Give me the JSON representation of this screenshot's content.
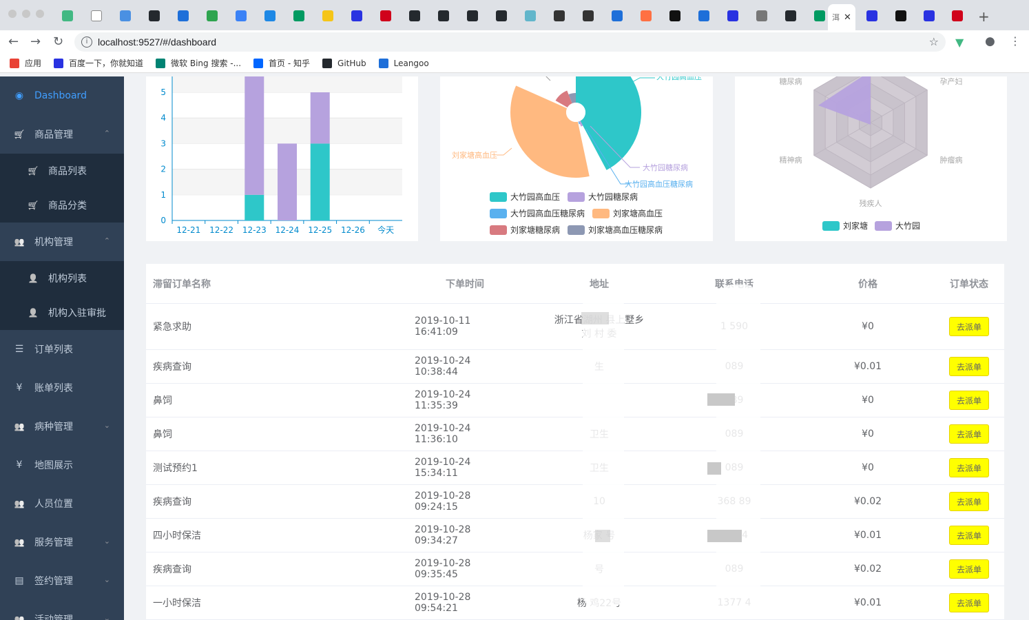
{
  "browser": {
    "url": "localhost:9527/#/dashboard",
    "active_tab_label": "洱"
  },
  "bookmarks": [
    {
      "label": "应用",
      "icon": "apps-grid-icon",
      "color": "#e94235"
    },
    {
      "label": "百度一下，你就知道",
      "icon": "baidu-paw-icon",
      "color": "#2932e1"
    },
    {
      "label": "微软 Bing 搜索 -...",
      "icon": "bing-icon",
      "color": "#008373"
    },
    {
      "label": "首页 - 知乎",
      "icon": "zhihu-icon",
      "color": "#0066ff"
    },
    {
      "label": "GitHub",
      "icon": "github-icon",
      "color": "#24292e"
    },
    {
      "label": "Leangoo",
      "icon": "leangoo-icon",
      "color": "#1e6fd9"
    }
  ],
  "sidebar": {
    "items": [
      {
        "label": "Dashboard",
        "icon": "dashboard-icon",
        "active": true
      },
      {
        "label": "商品管理",
        "icon": "cart-icon",
        "arrow": "up"
      },
      {
        "label": "商品列表",
        "icon": "cart-icon",
        "sub": true
      },
      {
        "label": "商品分类",
        "icon": "cart-icon",
        "sub": true
      },
      {
        "label": "机构管理",
        "icon": "user-icon",
        "arrow": "up"
      },
      {
        "label": "机构列表",
        "icon": "person-icon",
        "sub": true
      },
      {
        "label": "机构入驻审批",
        "icon": "person-icon",
        "sub": true
      },
      {
        "label": "订单列表",
        "icon": "list-icon"
      },
      {
        "label": "账单列表",
        "icon": "yen-icon"
      },
      {
        "label": "病种管理",
        "icon": "user-icon",
        "arrow": "down"
      },
      {
        "label": "地图展示",
        "icon": "yen-icon"
      },
      {
        "label": "人员位置",
        "icon": "user-icon"
      },
      {
        "label": "服务管理",
        "icon": "user-icon",
        "arrow": "down"
      },
      {
        "label": "签约管理",
        "icon": "document-icon",
        "arrow": "down"
      },
      {
        "label": "活动管理",
        "icon": "user-icon",
        "arrow": "down"
      }
    ]
  },
  "chart_data": [
    {
      "type": "bar",
      "stacked": true,
      "categories": [
        "12-21",
        "12-22",
        "12-23",
        "12-24",
        "12-25",
        "12-26",
        "今天"
      ],
      "yticks": [
        "0",
        "1",
        "2",
        "3",
        "4",
        "5"
      ],
      "ylim": [
        0,
        5
      ],
      "series": [
        {
          "values": [
            0,
            0,
            1,
            0,
            3,
            0,
            0
          ],
          "color": "#2ec7c9"
        },
        {
          "values": [
            0,
            0,
            5,
            3,
            2,
            0,
            0
          ],
          "color": "#b6a2de"
        }
      ]
    },
    {
      "type": "pie",
      "rose": true,
      "labels_shown": [
        "大竹园高血压",
        "刘家塘高血压",
        "大竹园糖尿病",
        "大竹园高血压糖尿病"
      ],
      "legend": [
        "大竹园高血压",
        "大竹园糖尿病",
        "大竹园高血压糖尿病",
        "刘家塘高血压",
        "刘家塘糖尿病",
        "刘家塘高血压糖尿病"
      ],
      "colors": [
        "#2ec7c9",
        "#b6a2de",
        "#5ab1ef",
        "#ffb980",
        "#d87a80",
        "#8d98b3"
      ]
    },
    {
      "type": "radar",
      "indicators": [
        "糖尿病",
        "孕产妇",
        "肿瘤病",
        "残疾人",
        "精神病"
      ],
      "legend": [
        "刘家塘",
        "大竹园"
      ],
      "colors": [
        "#2ec7c9",
        "#b6a2de"
      ]
    }
  ],
  "table": {
    "headers": [
      "滞留订单名称",
      "下单时间",
      "地址",
      "联系电话",
      "价格",
      "订单状态"
    ],
    "button_label": "去派单",
    "rows": [
      {
        "name": "紧急求助",
        "time": "2019-10-11 16:41:09",
        "addr": "浙江省湖州      县上墅乡\n刘      村      委",
        "phone": "1          590",
        "price": "¥0"
      },
      {
        "name": "疾病查询",
        "time": "2019-10-24 10:38:44",
        "addr": "生",
        "phone": "089",
        "price": "¥0.01"
      },
      {
        "name": "鼻饲",
        "time": "2019-10-24 11:35:39",
        "addr": "",
        "phone": "089",
        "price": "¥0"
      },
      {
        "name": "鼻饲",
        "time": "2019-10-24 11:36:10",
        "addr": "卫生",
        "phone": "089",
        "price": "¥0"
      },
      {
        "name": "测试预约1",
        "time": "2019-10-24 15:34:11",
        "addr": "卫生",
        "phone": "089",
        "price": "¥0"
      },
      {
        "name": "疾病查询",
        "time": "2019-10-28 09:24:15",
        "addr": "10",
        "phone": "368   89",
        "price": "¥0.02"
      },
      {
        "name": "四小时保洁",
        "time": "2019-10-28 09:34:27",
        "addr": "杨家      号",
        "phone": "77     24",
        "price": "¥0.01"
      },
      {
        "name": "疾病查询",
        "time": "2019-10-28 09:35:45",
        "addr": "号",
        "phone": "089",
        "price": "¥0.02"
      },
      {
        "name": "一小时保洁",
        "time": "2019-10-28 09:54:21",
        "addr": "杨      鸡22号",
        "phone": "1377        4",
        "price": "¥0.01"
      }
    ]
  }
}
